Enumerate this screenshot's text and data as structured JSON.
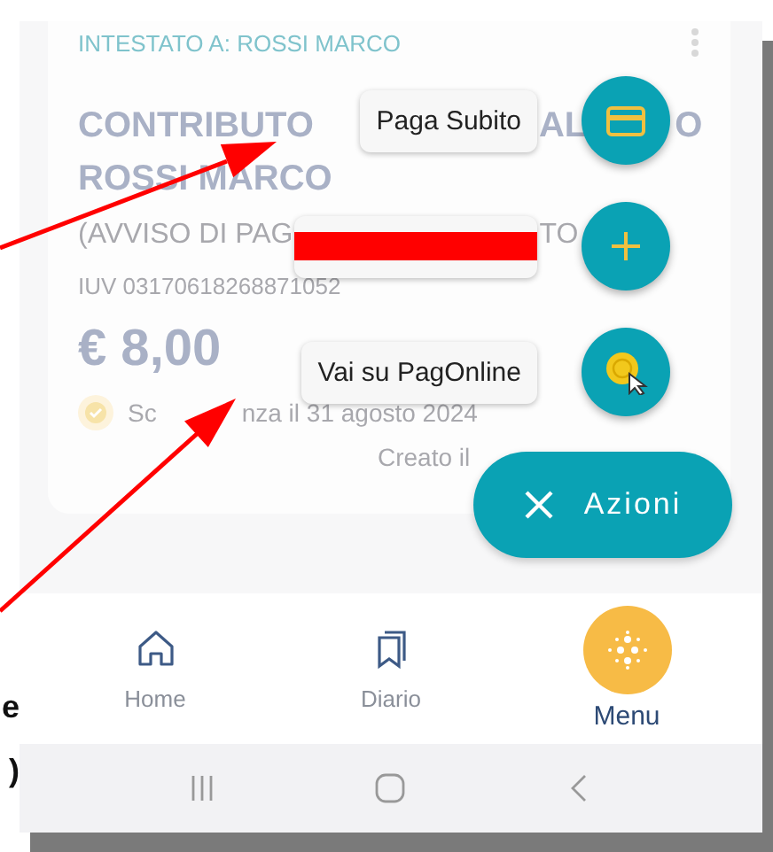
{
  "annotation_texts": [
    "e",
    ")"
  ],
  "card": {
    "holder": "INTESTATO A: ROSSI MARCO",
    "title_line_1": [
      "CONTRIBUTO",
      "AL",
      "O"
    ],
    "title_line_2": "ROSSI MARCO",
    "subtitle": [
      "(AVVISO DI PAG",
      "TO"
    ],
    "iuv": "IUV 03170618268871052",
    "amount": "€ 8,00",
    "due": [
      "Sc",
      "nza il 31 agosto 2024"
    ],
    "created": "Creato il"
  },
  "actions": [
    {
      "kind": "card",
      "label": "Paga Subito",
      "redacted": false
    },
    {
      "kind": "plus",
      "redacted": true
    },
    {
      "kind": "coin",
      "label": "Vai su PagOnline",
      "redacted": false
    }
  ],
  "fab": {
    "label": "Azioni"
  },
  "nav": [
    {
      "kind": "home",
      "label": "Home",
      "selected": false
    },
    {
      "kind": "diario",
      "label": "Diario",
      "selected": false
    },
    {
      "kind": "menu",
      "label": "Menu",
      "selected": true
    }
  ]
}
